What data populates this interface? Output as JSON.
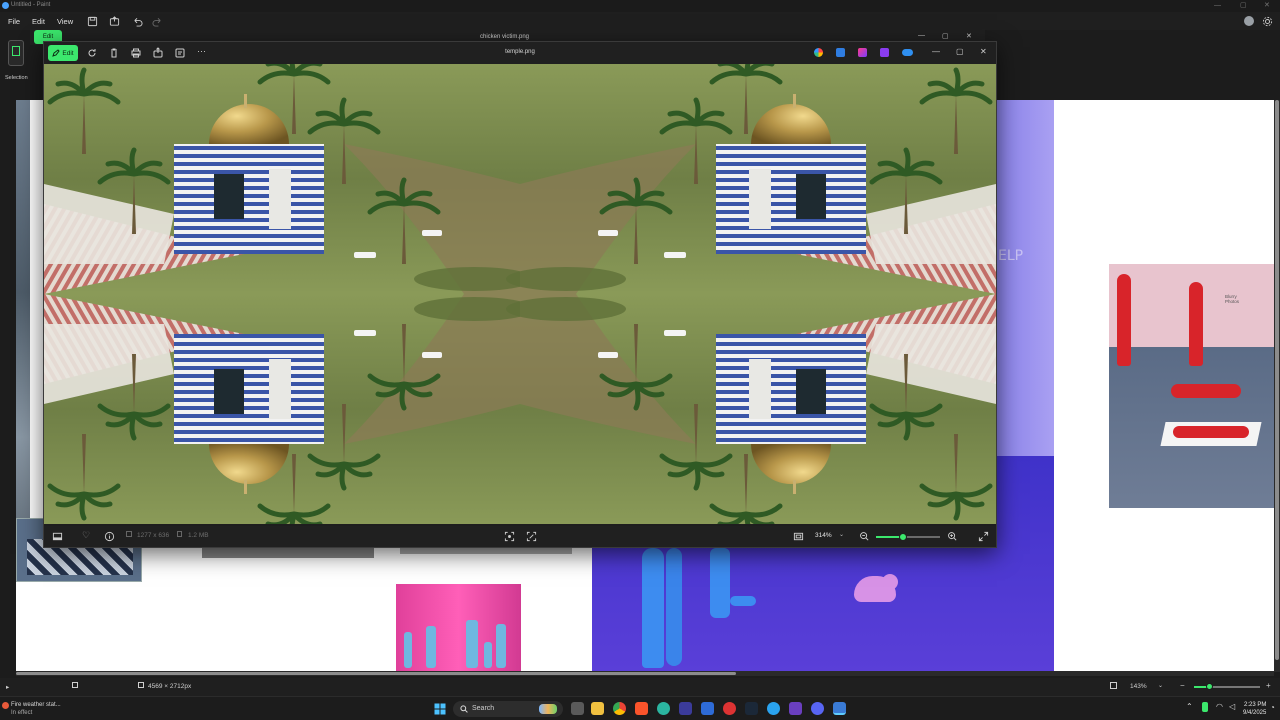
{
  "paint": {
    "window_title": "Untitled - Paint",
    "menu": [
      "File",
      "Edit",
      "View"
    ],
    "selection_label": "Selection",
    "status": {
      "canvas_size": "4569 × 2712px",
      "zoom": "143%"
    },
    "canvas_text_help": "ELP",
    "canvas_text_note": "Blurry\nPhotos"
  },
  "photos_back": {
    "title": "chicken victim.png",
    "edit_label": "Edit"
  },
  "photos": {
    "title": "temple.png",
    "edit_label": "Edit",
    "footer": {
      "dimensions": "1277 x 636",
      "file_size": "1.2 MB",
      "zoom": "314%",
      "zoom_fraction": 0.42
    }
  },
  "taskbar": {
    "weather_title": "Fire weather stat...",
    "weather_sub": "In effect",
    "search_placeholder": "Search",
    "time": "2:23 PM",
    "date": "9/4/2025"
  },
  "colors": {
    "accent_green": "#3ce86d",
    "purple_panel": "#5b4fe0",
    "pink_panel": "#e0409a"
  }
}
